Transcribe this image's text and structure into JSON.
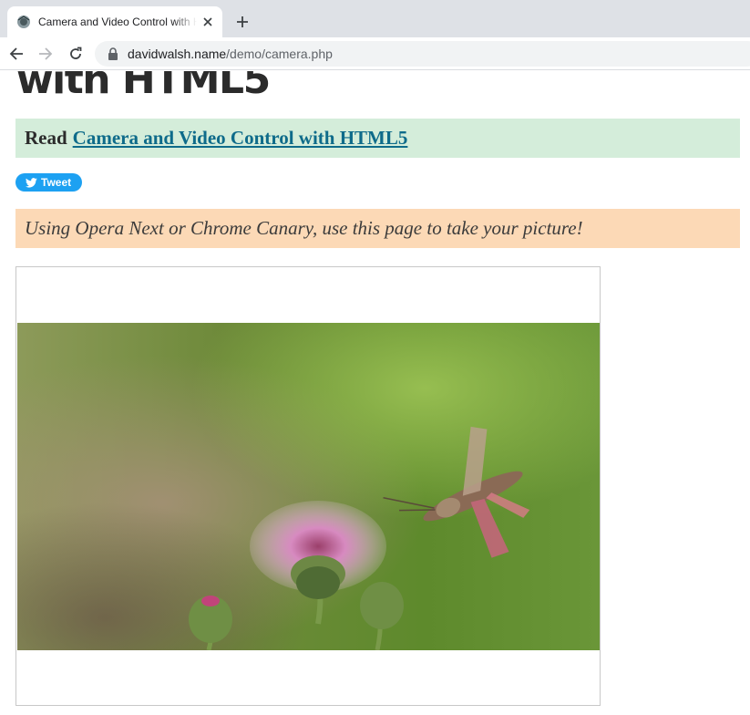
{
  "browser": {
    "tab": {
      "title": "Camera and Video Control with HTML5",
      "favicon": "site-favicon"
    },
    "toolbar": {
      "url_host": "davidwalsh.name",
      "url_path": "/demo/camera.php"
    }
  },
  "page": {
    "title": "with HTML5",
    "read_prefix": "Read",
    "read_link": "Camera and Video Control with HTML5",
    "tweet_label": "Tweet",
    "notice": "Using Opera Next or Chrome Canary, use this page to take your picture!",
    "video": {
      "subject": "hummingbird moth feeding on thistle flower"
    }
  },
  "colors": {
    "read_box_bg": "#d4edda",
    "notice_bg": "#fcd9b6",
    "link": "#0e6b8a",
    "tweet": "#1da1f2"
  }
}
